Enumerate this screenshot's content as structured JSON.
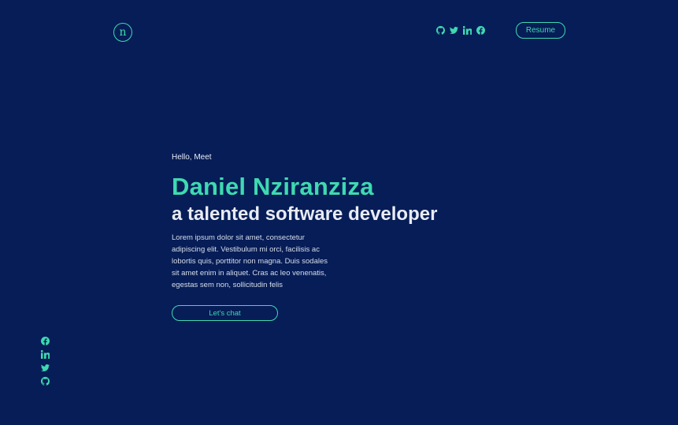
{
  "header": {
    "logo_text": "n",
    "social_icons": [
      "github-icon",
      "twitter-icon",
      "linkedin-icon",
      "facebook-icon"
    ],
    "resume_label": "Resume"
  },
  "hero": {
    "greeting": "Hello, Meet",
    "name": "Daniel Nziranziza",
    "tagline": "a talented software developer",
    "description": "Lorem ipsum dolor sit amet, consectetur adipiscing elit. Vestibulum mi orci, facilisis ac lobortis quis, porttitor non magna. Duis sodales sit amet enim in aliquet. Cras ac leo venenatis, egestas sem non, sollicitudin felis",
    "cta_label": "Let's chat"
  },
  "sidebar": {
    "social_icons": [
      "facebook-icon",
      "linkedin-icon",
      "twitter-icon",
      "github-icon"
    ]
  },
  "colors": {
    "background": "#061d57",
    "accent": "#3fd9b1",
    "text": "#e8ecf5"
  }
}
